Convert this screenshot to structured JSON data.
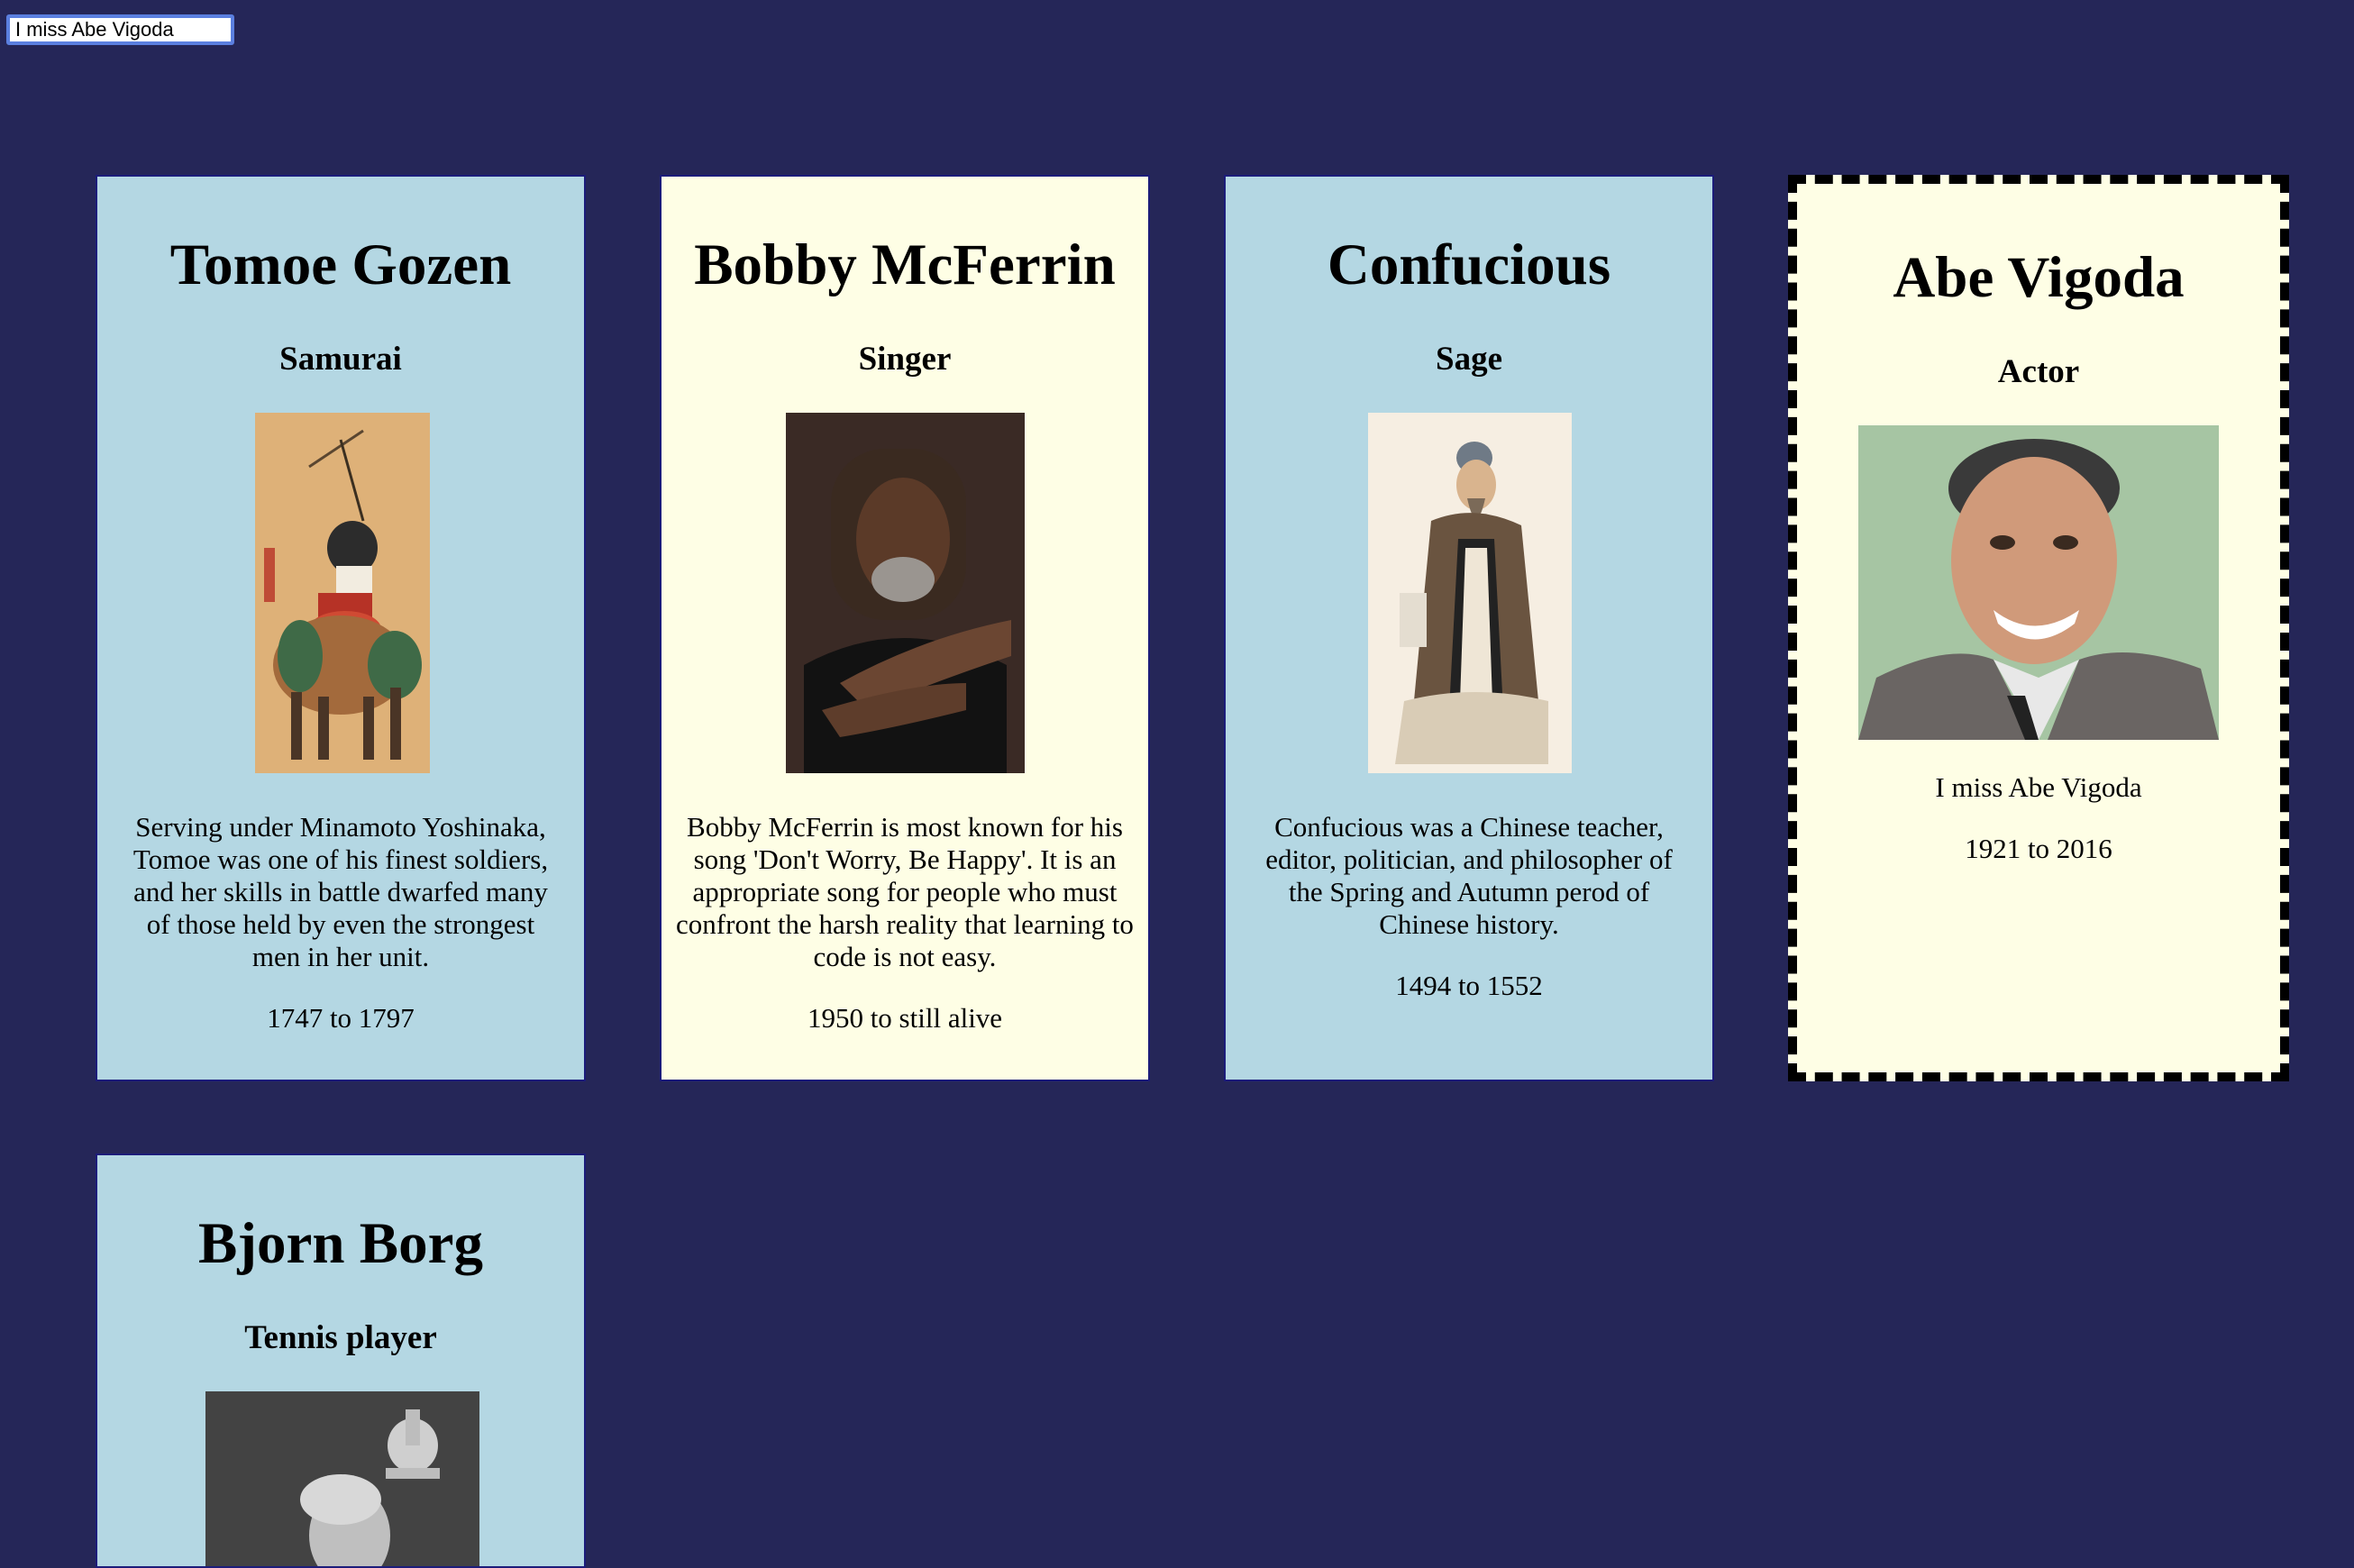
{
  "search": {
    "value": "I miss Abe Vigoda"
  },
  "cards": [
    {
      "name": "Tomoe Gozen",
      "role": "Samurai",
      "description": "Serving under Minamoto Yoshinaka, Tomoe was one of his finest soldiers, and her skills in battle dwarfed many of those held by even the strongest men in her unit.",
      "years": "1747 to 1797",
      "image": "samurai-painting-image"
    },
    {
      "name": "Bobby McFerrin",
      "role": "Singer",
      "description": "Bobby McFerrin is most known for his song 'Don't Worry, Be Happy'. It is an appropriate song for people who must confront the harsh reality that learning to code is not easy.",
      "years": "1950 to still alive",
      "image": "singer-portrait-image"
    },
    {
      "name": "Confucious",
      "role": "Sage",
      "description": "Confucious was a Chinese teacher, editor, politician, and philosopher of the Spring and Autumn perod of Chinese history.",
      "years": "1494 to 1552",
      "image": "sage-painting-image"
    },
    {
      "name": "Abe Vigoda",
      "role": "Actor",
      "description": "I miss Abe Vigoda",
      "years": "1921 to 2016",
      "image": "actor-portrait-image"
    },
    {
      "name": "Bjorn Borg",
      "role": "Tennis player",
      "description": "",
      "years": "",
      "image": "tennis-player-photo-image"
    }
  ],
  "colors": {
    "page_background": "#252658",
    "card_blue": "#b4d7e3",
    "card_cream": "#fefee5",
    "card_border": "#1c1c7a",
    "selected_border": "#000000",
    "input_focus_ring": "#5b7fe0"
  }
}
